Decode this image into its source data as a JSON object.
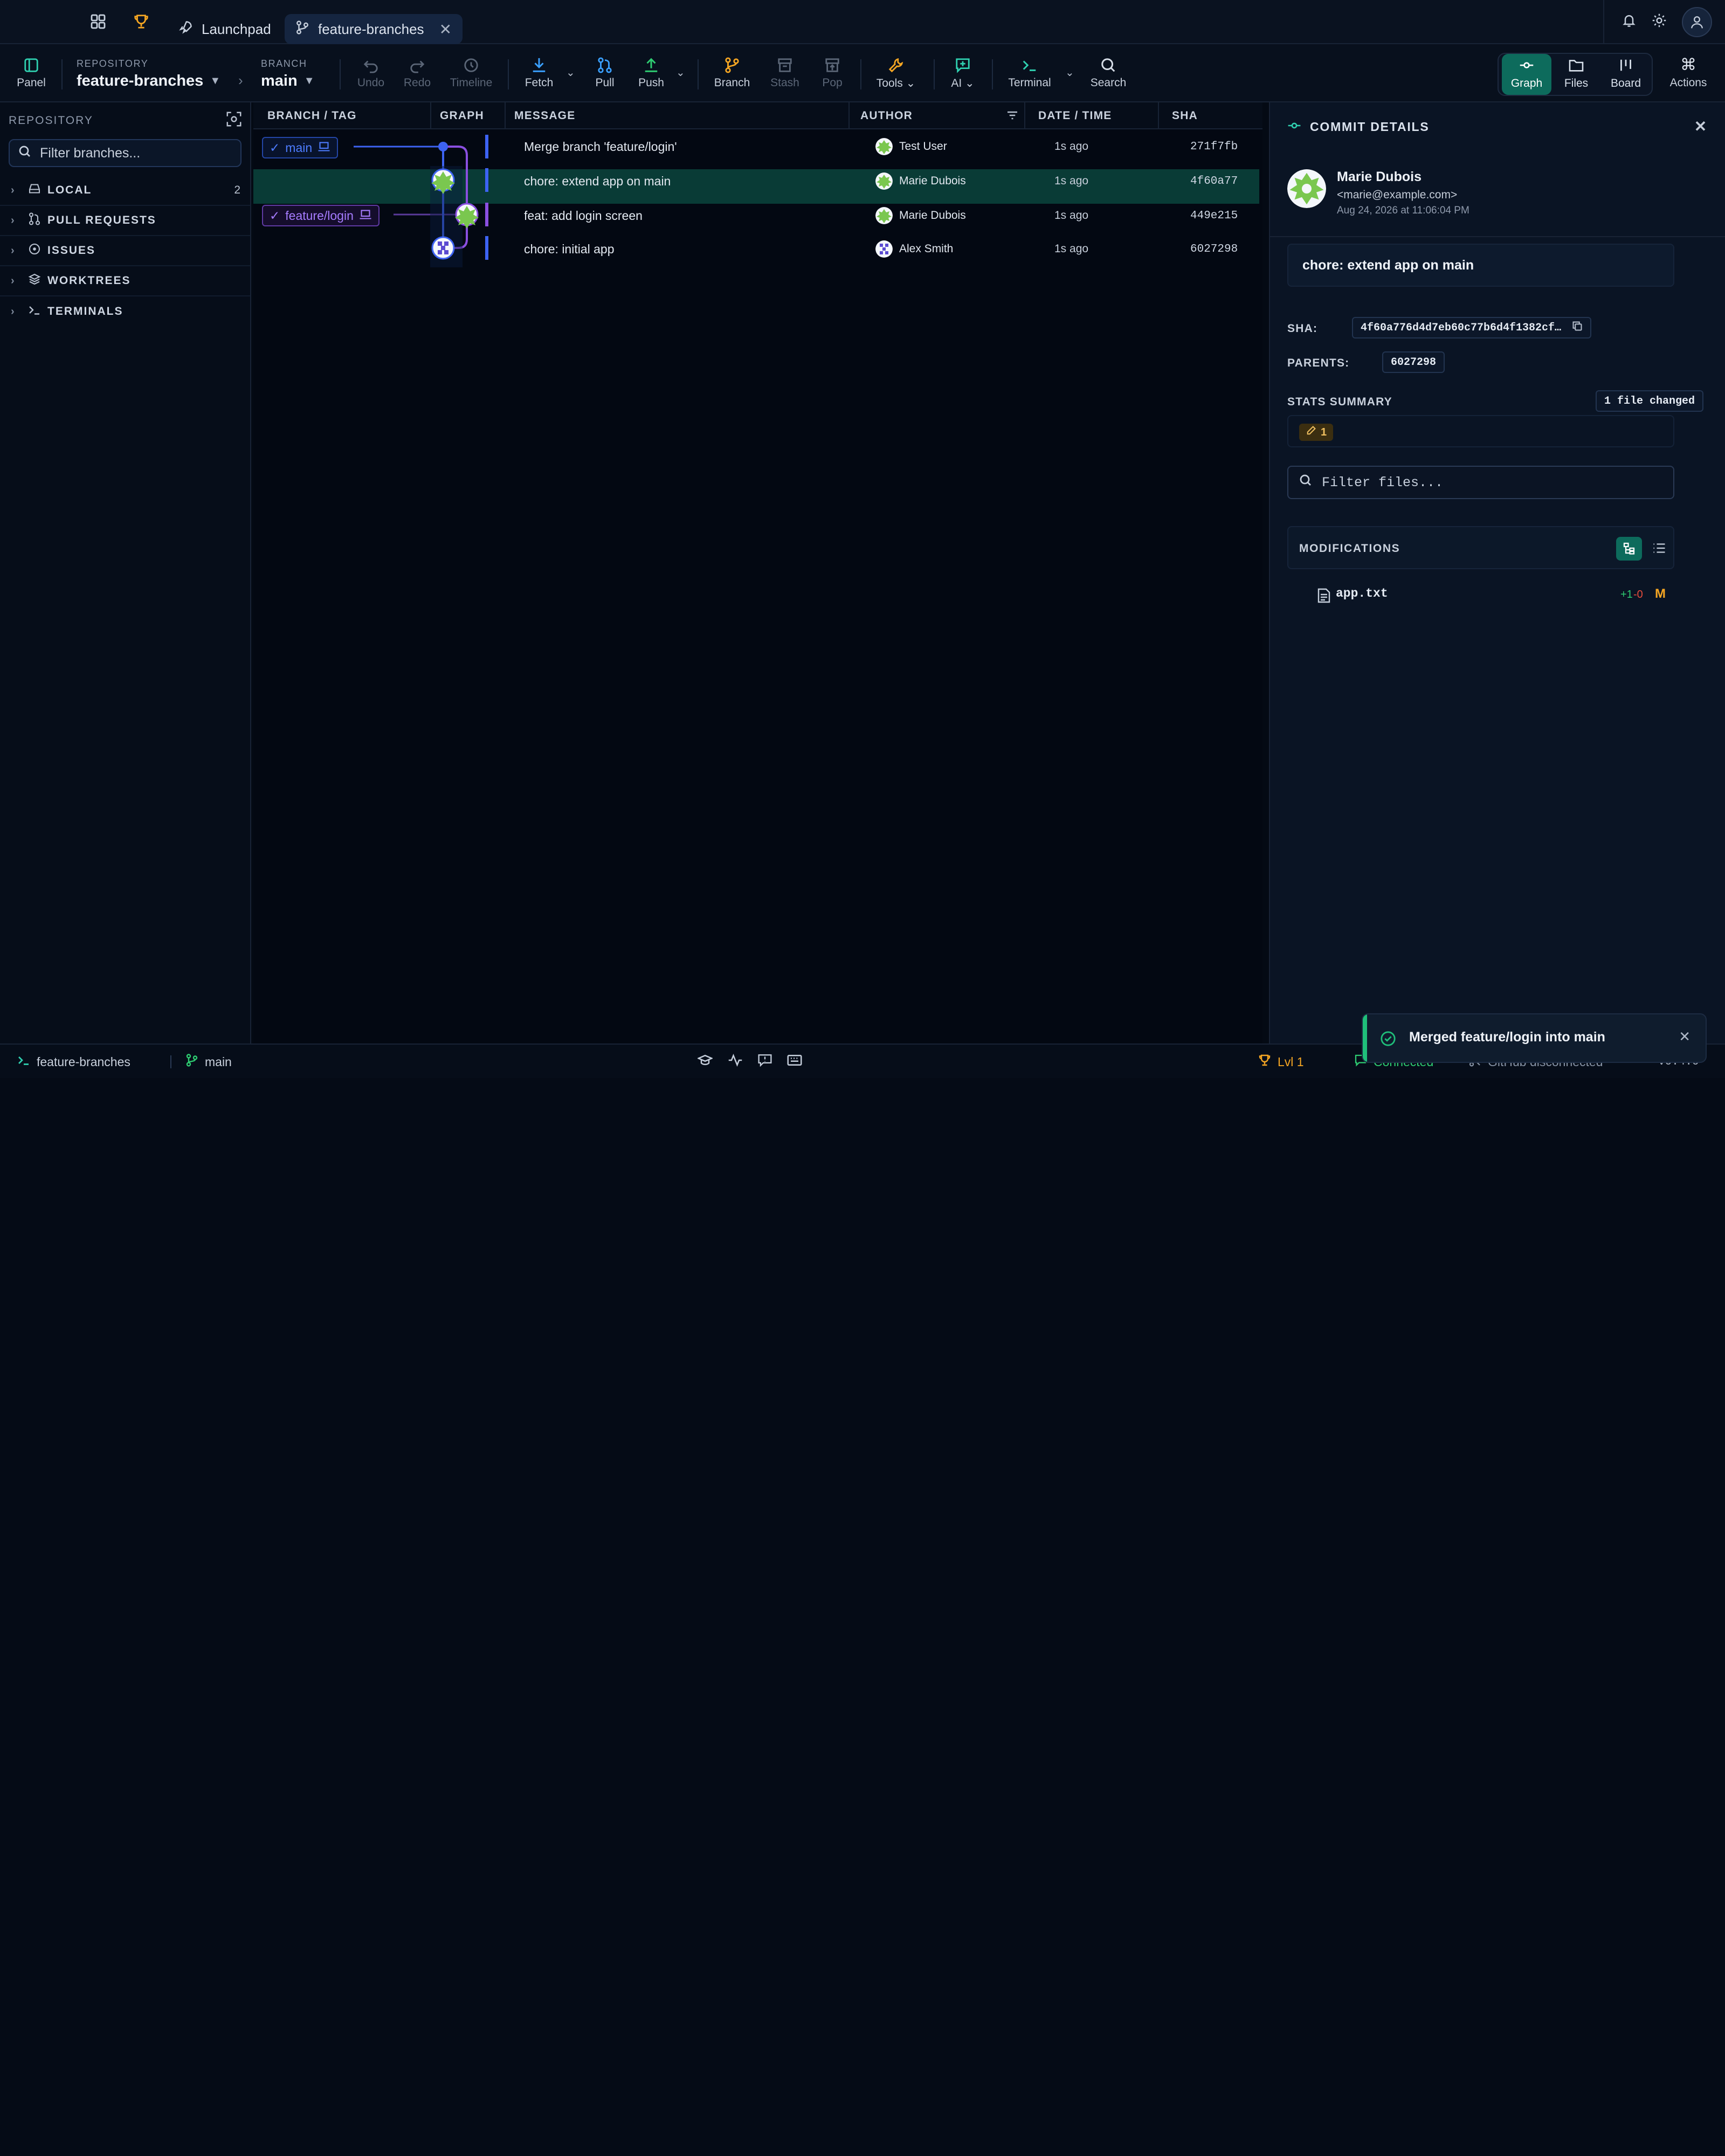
{
  "tabs": {
    "launchpad": "Launchpad",
    "active_tab": "feature-branches"
  },
  "toolbar": {
    "panel": "Panel",
    "repo_label": "REPOSITORY",
    "repo_value": "feature-branches",
    "branch_label": "BRANCH",
    "branch_value": "main",
    "undo": "Undo",
    "redo": "Redo",
    "timeline": "Timeline",
    "fetch": "Fetch",
    "pull": "Pull",
    "push": "Push",
    "branch": "Branch",
    "stash": "Stash",
    "pop": "Pop",
    "tools": "Tools",
    "ai": "AI",
    "terminal": "Terminal",
    "search": "Search",
    "views": [
      "Graph",
      "Files",
      "Board"
    ],
    "actions": "Actions"
  },
  "sidebar": {
    "header": "REPOSITORY",
    "filter_placeholder": "Filter branches...",
    "sections": [
      {
        "label": "LOCAL",
        "count": "2"
      },
      {
        "label": "PULL REQUESTS",
        "count": ""
      },
      {
        "label": "ISSUES",
        "count": ""
      },
      {
        "label": "WORKTREES",
        "count": ""
      },
      {
        "label": "TERMINALS",
        "count": ""
      }
    ]
  },
  "commit_table": {
    "columns": [
      "BRANCH / TAG",
      "GRAPH",
      "MESSAGE",
      "AUTHOR",
      "DATE / TIME",
      "SHA"
    ],
    "refs": {
      "main": "main",
      "login": "feature/login"
    },
    "rows": [
      {
        "message": "Merge branch 'feature/login'",
        "author": "Test User",
        "date": "1s ago",
        "sha": "271f7fb"
      },
      {
        "message": "chore: extend app on main",
        "author": "Marie Dubois",
        "date": "1s ago",
        "sha": "4f60a77"
      },
      {
        "message": "feat: add login screen",
        "author": "Marie Dubois",
        "date": "1s ago",
        "sha": "449e215"
      },
      {
        "message": "chore: initial app",
        "author": "Alex Smith",
        "date": "1s ago",
        "sha": "6027298"
      }
    ]
  },
  "details": {
    "title": "COMMIT DETAILS",
    "author_name": "Marie Dubois",
    "author_email": "<marie@example.com>",
    "author_date": "Aug 24, 2026 at 11:06:04 PM",
    "message": "chore: extend app on main",
    "sha_label": "SHA:",
    "sha_value": "4f60a776d4d7eb60c77b6d4f1382cf…",
    "parents_label": "PARENTS:",
    "parents_value": "6027298",
    "stats_label": "STATS SUMMARY",
    "files_changed": "1 file changed",
    "edits": "1",
    "filter_placeholder": "Filter files...",
    "modifications_label": "MODIFICATIONS",
    "file_name": "app.txt",
    "file_add": "+1",
    "file_del": "-0",
    "file_status": "M"
  },
  "status": {
    "repo": "feature-branches",
    "branch": "main",
    "level": "Lvl 1",
    "connected": "Connected",
    "github": "GitHub disconnected",
    "version": "v0.4.0"
  },
  "toast": {
    "message": "Merged feature/login into main"
  },
  "colors": {
    "accent": "#0d6b5c",
    "main_lane": "#3d63f2",
    "login_lane": "#8a4fe0",
    "success": "#1fbf7a"
  }
}
